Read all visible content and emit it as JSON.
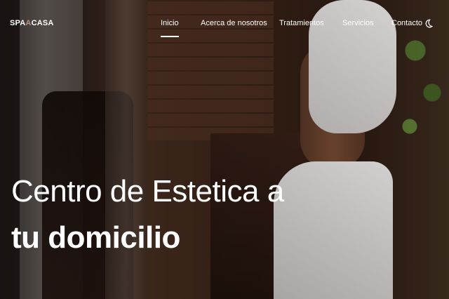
{
  "brand": {
    "part1": "SPA",
    "part2": "A",
    "part3": "CASA"
  },
  "nav": {
    "items": [
      {
        "label": "Inicio",
        "active": true
      },
      {
        "label": "Acerca de nosotros",
        "active": false
      },
      {
        "label": "Tratamientos",
        "active": false
      },
      {
        "label": "Servicios",
        "active": false
      },
      {
        "label": "Contacto",
        "active": false
      }
    ],
    "theme_toggle_icon": "moon-icon"
  },
  "hero": {
    "headline_line1": "Centro de Estetica a",
    "headline_line2": "tu domicilio"
  },
  "colors": {
    "text": "#ffffff",
    "overlay": "#000000"
  }
}
